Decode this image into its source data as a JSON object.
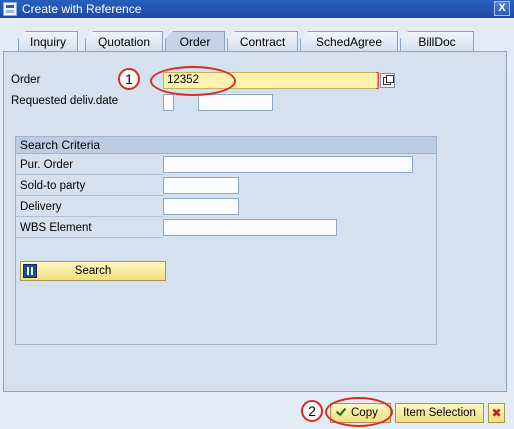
{
  "window": {
    "title": "Create with Reference",
    "close_glyph": "X"
  },
  "tabs": [
    {
      "label": "Inquiry"
    },
    {
      "label": "Quotation"
    },
    {
      "label": "Order"
    },
    {
      "label": "Contract"
    },
    {
      "label": "SchedAgree"
    },
    {
      "label": "BillDoc"
    }
  ],
  "active_tab": "Order",
  "form": {
    "order_label": "Order",
    "order_value": "12352",
    "requested_date_label": "Requested deliv.date",
    "requested_date_from": "",
    "requested_date_to": ""
  },
  "search_criteria": {
    "header": "Search Criteria",
    "fields": [
      {
        "label": "Pur. Order",
        "value": ""
      },
      {
        "label": "Sold-to party",
        "value": ""
      },
      {
        "label": "Delivery",
        "value": ""
      },
      {
        "label": "WBS Element",
        "value": ""
      }
    ],
    "search_button_label": "Search"
  },
  "footer": {
    "copy_label": "Copy",
    "item_selection_label": "Item Selection",
    "cancel_glyph": "✖"
  },
  "annotations": {
    "step1": "1",
    "step2": "2"
  },
  "colors": {
    "title_bar": "#1d4aa5",
    "panel_bg": "#d5e1ef",
    "highlight_field": "#fff2ae",
    "button_yellow": "#f2df7c",
    "annotation_red": "#d92c20"
  }
}
